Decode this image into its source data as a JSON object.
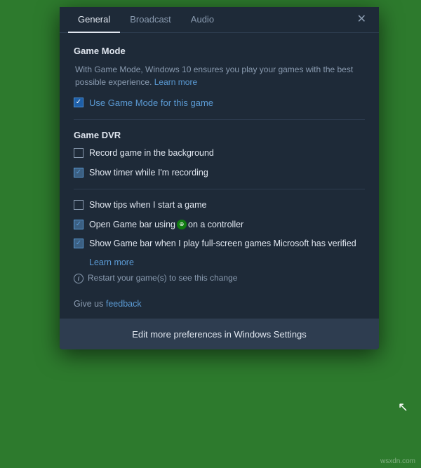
{
  "tabs": [
    {
      "id": "general",
      "label": "General",
      "active": true
    },
    {
      "id": "broadcast",
      "label": "Broadcast",
      "active": false
    },
    {
      "id": "audio",
      "label": "Audio",
      "active": false
    }
  ],
  "close_button_symbol": "✕",
  "sections": {
    "game_mode": {
      "title": "Game Mode",
      "description": "With Game Mode, Windows 10 ensures you play your games with the best possible experience.",
      "learn_more_label": "Learn more",
      "checkbox_label": "Use Game Mode for this game",
      "checked": true
    },
    "game_dvr": {
      "title": "Game DVR",
      "items": [
        {
          "label": "Record game in the background",
          "checked": false
        },
        {
          "label": "Show timer while I'm recording",
          "checked": true
        }
      ]
    },
    "general_settings": {
      "items": [
        {
          "label": "Show tips when I start a game",
          "checked": false
        },
        {
          "label": "Open Game bar using",
          "has_xbox_icon": true,
          "suffix": "on a controller",
          "checked": true
        },
        {
          "label": "Show Game bar when I play full-screen games Microsoft has verified",
          "checked": true
        }
      ],
      "learn_more_label": "Learn more",
      "restart_notice": "Restart your game(s) to see this change"
    }
  },
  "feedback": {
    "prefix": "Give us ",
    "link_label": "feedback"
  },
  "bottom_button_label": "Edit more preferences in Windows Settings",
  "watermark": "wsxdn.com"
}
